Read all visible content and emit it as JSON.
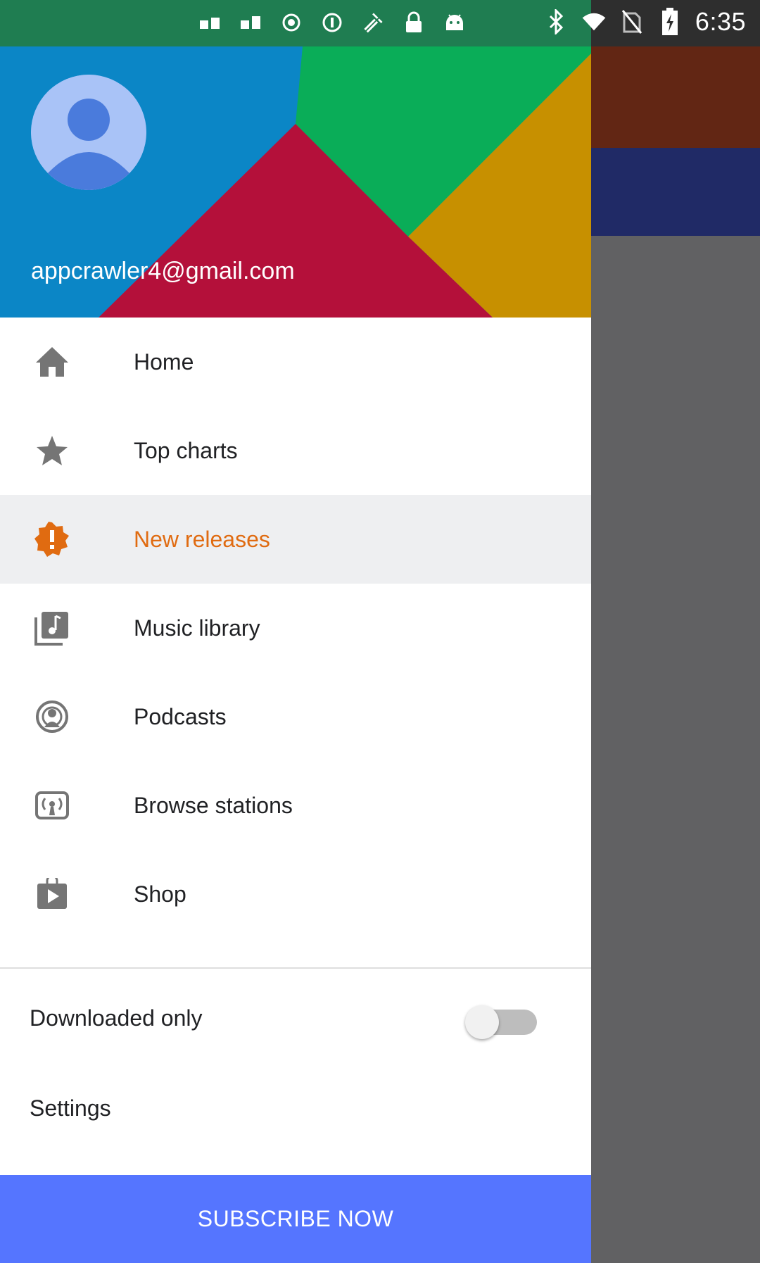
{
  "status_bar": {
    "time": "6:35",
    "left_icons": [
      "notification-icon",
      "notification-icon",
      "target-icon",
      "info-icon",
      "satellite-icon",
      "lock-icon",
      "android-icon"
    ],
    "right_icons": [
      "bluetooth-icon",
      "wifi-icon",
      "no-sim-icon",
      "battery-charging-icon"
    ]
  },
  "drawer": {
    "account": {
      "email": "appcrawler4@gmail.com"
    },
    "nav_items": [
      {
        "label": "Home",
        "icon": "home-icon",
        "selected": false
      },
      {
        "label": "Top charts",
        "icon": "star-icon",
        "selected": false
      },
      {
        "label": "New releases",
        "icon": "alert-badge-icon",
        "selected": true
      },
      {
        "label": "Music library",
        "icon": "music-library-icon",
        "selected": false
      },
      {
        "label": "Podcasts",
        "icon": "podcast-icon",
        "selected": false
      },
      {
        "label": "Browse stations",
        "icon": "radio-icon",
        "selected": false
      },
      {
        "label": "Shop",
        "icon": "play-store-icon",
        "selected": false
      }
    ],
    "downloaded_only": {
      "label": "Downloaded only",
      "on": false
    },
    "settings_label": "Settings",
    "subscribe_label": "SUBSCRIBE NOW"
  },
  "colors": {
    "accent": "#e06b11",
    "subscribe_bg": "#5575ff",
    "header_blue": "#0b86c6",
    "header_green": "#0aad58",
    "header_red": "#b4103a",
    "header_gold": "#c79000"
  }
}
